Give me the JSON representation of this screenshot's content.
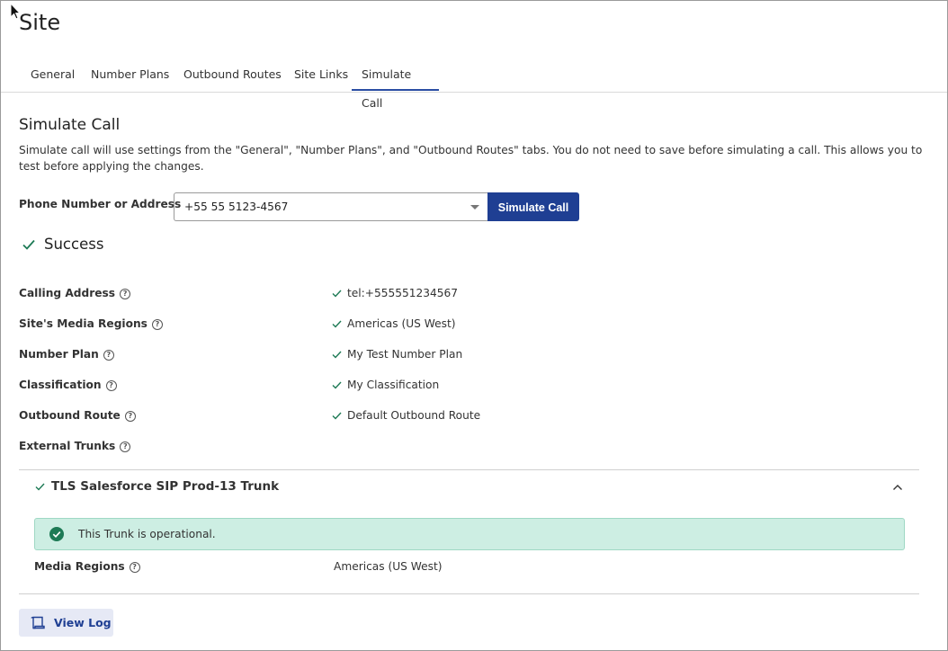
{
  "page": {
    "title": "Site"
  },
  "tabs": [
    {
      "label": "General"
    },
    {
      "label": "Number Plans"
    },
    {
      "label": "Outbound Routes"
    },
    {
      "label": "Site Links"
    },
    {
      "label": "Simulate Call"
    }
  ],
  "active_tab": "Simulate Call",
  "simulate": {
    "title": "Simulate Call",
    "description": "Simulate call will use settings from the \"General\", \"Number Plans\", and \"Outbound Routes\" tabs. You do not need to save before simulating a call. This allows you to test before applying the changes.",
    "field_label": "Phone Number or Address",
    "field_value": "+55 55 5123-4567",
    "button_label": "Simulate Call"
  },
  "result": {
    "status": "Success",
    "rows": [
      {
        "label": "Calling Address",
        "value": "tel:+555551234567"
      },
      {
        "label": "Site's Media Regions",
        "value": "Americas (US West)"
      },
      {
        "label": "Number Plan",
        "value": "My Test Number Plan"
      },
      {
        "label": "Classification",
        "value": "My Classification"
      },
      {
        "label": "Outbound Route",
        "value": "Default Outbound Route"
      },
      {
        "label": "External Trunks",
        "value": ""
      }
    ]
  },
  "trunk": {
    "name": "TLS Salesforce SIP Prod-13 Trunk",
    "status_message": "This Trunk is operational.",
    "media_regions_label": "Media Regions",
    "media_regions_value": "Americas (US West)"
  },
  "footer": {
    "view_log_label": "View Log"
  },
  "colors": {
    "accent": "#1f3f93",
    "success": "#1d7a55",
    "alert_bg": "#cdeee3"
  },
  "icons": {
    "success": "check-icon",
    "help": "question-circle-icon",
    "collapse": "chevron-up-icon",
    "log": "scroll-icon"
  }
}
